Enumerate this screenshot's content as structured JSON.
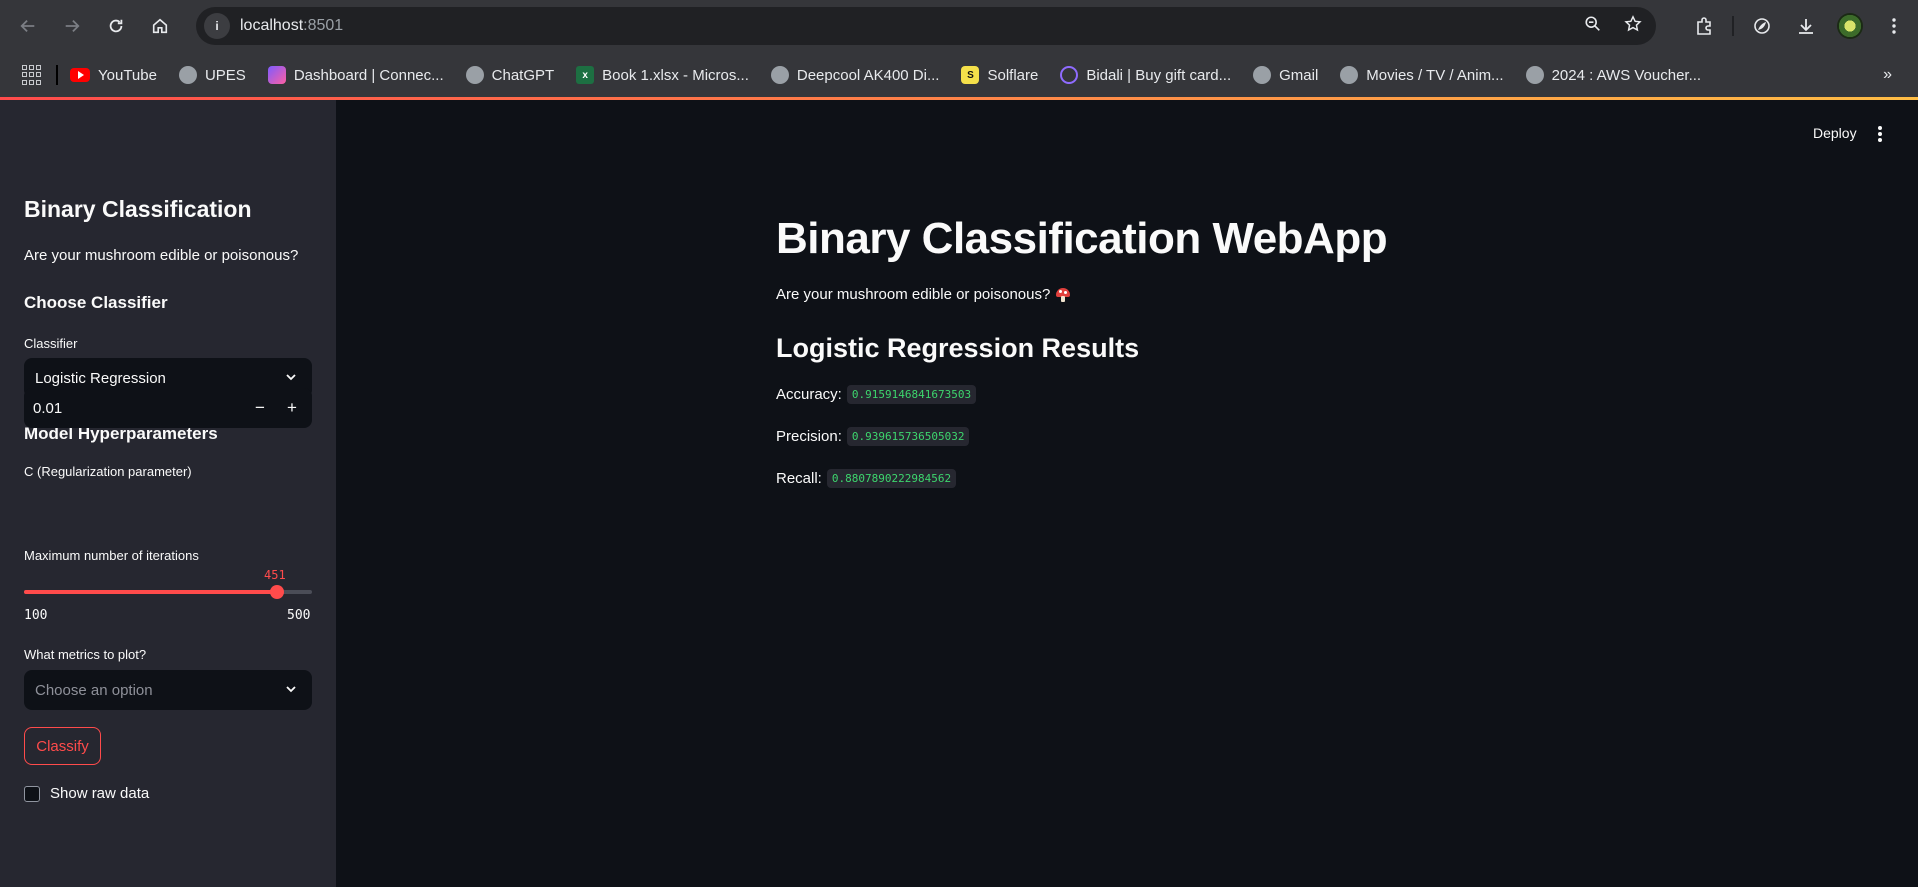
{
  "browser": {
    "url_host": "localhost",
    "url_port": ":8501",
    "site_info_glyph": "i",
    "bookmarks": [
      {
        "label": "YouTube",
        "icon": "youtube-icon"
      },
      {
        "label": "UPES",
        "icon": "globe-icon"
      },
      {
        "label": "Dashboard | Connec...",
        "icon": "dashboard-icon"
      },
      {
        "label": "ChatGPT",
        "icon": "globe-icon"
      },
      {
        "label": "Book 1.xlsx - Micros...",
        "icon": "excel-icon"
      },
      {
        "label": "Deepcool AK400 Di...",
        "icon": "globe-icon"
      },
      {
        "label": "Solflare",
        "icon": "solflare-icon"
      },
      {
        "label": "Bidali | Buy gift card...",
        "icon": "bidali-icon"
      },
      {
        "label": "Gmail",
        "icon": "globe-icon"
      },
      {
        "label": "Movies / TV / Anim...",
        "icon": "globe-icon"
      },
      {
        "label": "2024 : AWS Voucher...",
        "icon": "globe-icon"
      }
    ],
    "bookmarks_more": "»",
    "excel_glyph": "x",
    "solflare_glyph": "S"
  },
  "sidebar": {
    "title": "Binary Classification",
    "subtitle": "Are your mushroom edible or poisonous?",
    "choose_classifier": "Choose Classifier",
    "classifier_label": "Classifier",
    "classifier_value": "Logistic Regression",
    "hyperparams": "Model Hyperparameters",
    "c_label": "C (Regularization parameter)",
    "c_value": "0.01",
    "c_minus": "−",
    "c_plus": "+",
    "iter_label": "Maximum number of iterations",
    "iter_value": "451",
    "iter_min": "100",
    "iter_max": "500",
    "iter_fraction": 0.8775,
    "metrics_label": "What metrics to plot?",
    "metrics_placeholder": "Choose an option",
    "classify_label": "Classify",
    "raw_data_label": "Show raw data"
  },
  "main": {
    "deploy": "Deploy",
    "title": "Binary Classification WebApp",
    "subtitle": "Are your mushroom edible or poisonous?",
    "results_header": "Logistic Regression Results",
    "accuracy_label": "Accuracy:",
    "accuracy_value": "0.9159146841673503",
    "precision_label": "Precision:",
    "precision_value": "0.939615736505032",
    "recall_label": "Recall:",
    "recall_value": "0.8807890222984562"
  },
  "colors": {
    "primary": "#ff4b4b",
    "background": "#0e1117",
    "sidebar": "#262730",
    "code_text": "#3dd56d"
  }
}
